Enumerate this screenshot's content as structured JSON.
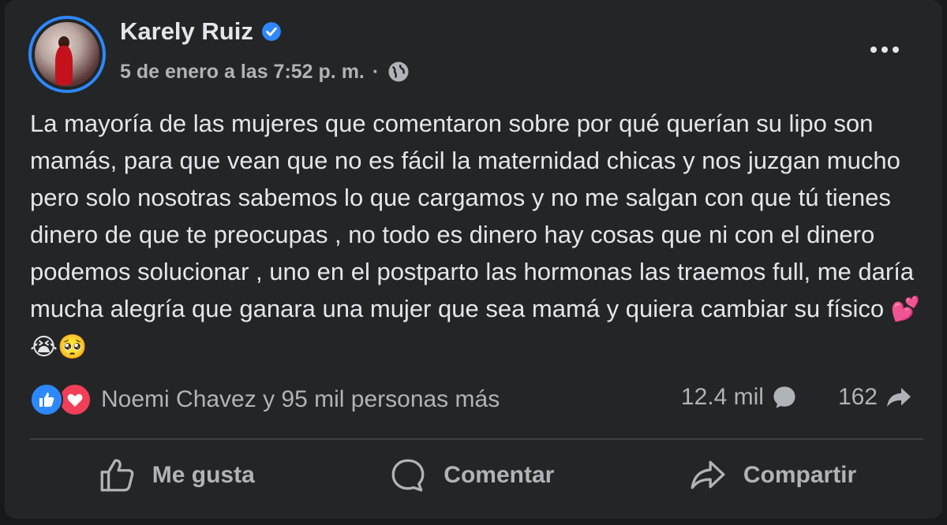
{
  "post": {
    "author": "Karely Ruiz",
    "timestamp": "5 de enero a las 7:52 p. m.",
    "separator": "·",
    "text": "La mayoría de las mujeres que comentaron sobre por qué querían su lipo son mamás, para que vean que no es fácil la maternidad chicas y nos juzgan mucho pero solo nosotras sabemos lo que cargamos y no me salgan con que tú tienes dinero de que te preocupas , no todo es dinero hay cosas que ni con el dinero podemos solucionar , uno en el postparto las hormonas las traemos full, me daría mucha alegría que ganara una mujer que sea mamá y quiera cambiar su físico",
    "emojis": "💕😭🥺"
  },
  "stats": {
    "reactions_text": "Noemi Chavez y 95 mil personas más",
    "comments_count": "12.4 mil",
    "shares_count": "162"
  },
  "actions": {
    "like": "Me gusta",
    "comment": "Comentar",
    "share": "Compartir"
  },
  "colors": {
    "background": "#242526",
    "text": "#e4e6eb",
    "secondary_text": "#b0b3b8",
    "verified": "#2d88ff",
    "like": "#2d88ff",
    "love": "#f33e58"
  },
  "icons": {
    "verified": "verified-badge-icon",
    "audience": "globe-icon",
    "more": "more-options-icon",
    "like_reaction": "like-reaction-icon",
    "love_reaction": "love-reaction-icon",
    "comments": "comment-bubble-icon",
    "shares": "share-arrow-icon"
  }
}
